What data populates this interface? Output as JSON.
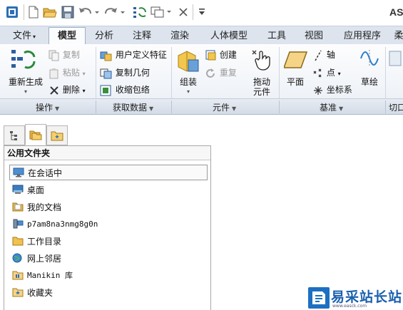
{
  "app": {
    "title": "AS"
  },
  "quick_access": [
    {
      "name": "window-icon"
    },
    {
      "name": "new-file-icon"
    },
    {
      "name": "open-folder-icon"
    },
    {
      "name": "save-icon"
    },
    {
      "name": "undo-icon"
    },
    {
      "name": "redo-icon"
    },
    {
      "name": "regenerate-icon"
    },
    {
      "name": "windows-icon"
    },
    {
      "name": "close-window-icon"
    },
    {
      "name": "customize-icon"
    }
  ],
  "tabs": [
    {
      "label": "文件",
      "caret": "▾"
    },
    {
      "label": "模型"
    },
    {
      "label": "分析"
    },
    {
      "label": "注释"
    },
    {
      "label": "渲染"
    },
    {
      "label": "人体模型"
    },
    {
      "label": "工具"
    },
    {
      "label": "视图"
    },
    {
      "label": "应用程序"
    },
    {
      "label": "柔"
    }
  ],
  "ribbon": {
    "regenerate": {
      "label": "重新生成",
      "caret": "▾"
    },
    "copy": "复制",
    "paste": "粘贴",
    "delete": "删除",
    "user_feature": "用户定义特征",
    "copy_geometry": "复制几何",
    "shrinkwrap": "收缩包络",
    "assemble": "组装",
    "create": "创建",
    "repeat": "重复",
    "drag": {
      "line1": "拖动",
      "line2": "元件"
    },
    "plane": "平面",
    "axis": "轴",
    "point": "点",
    "csys": "坐标系",
    "sketch": "草绘"
  },
  "groups": {
    "operations": "操作",
    "get_data": "获取数据",
    "component": "元件",
    "datum": "基准",
    "cut": "切口"
  },
  "navigator": {
    "header": "公用文件夹",
    "items": [
      {
        "label": "在会话中",
        "icon": "monitor-icon",
        "selected": true
      },
      {
        "label": "桌面",
        "icon": "desktop-icon"
      },
      {
        "label": "我的文档",
        "icon": "documents-icon"
      },
      {
        "label": "p7am8na3nmg8g0n",
        "icon": "computer-icon",
        "mono": true
      },
      {
        "label": "工作目录",
        "icon": "folder-icon"
      },
      {
        "label": "网上邻居",
        "icon": "network-icon"
      },
      {
        "label": "Manikin 库",
        "icon": "library-icon",
        "mono": true
      },
      {
        "label": "收藏夹",
        "icon": "favorites-icon"
      }
    ]
  },
  "watermark": {
    "text": "易采站长站",
    "url": "www.easck.com"
  }
}
